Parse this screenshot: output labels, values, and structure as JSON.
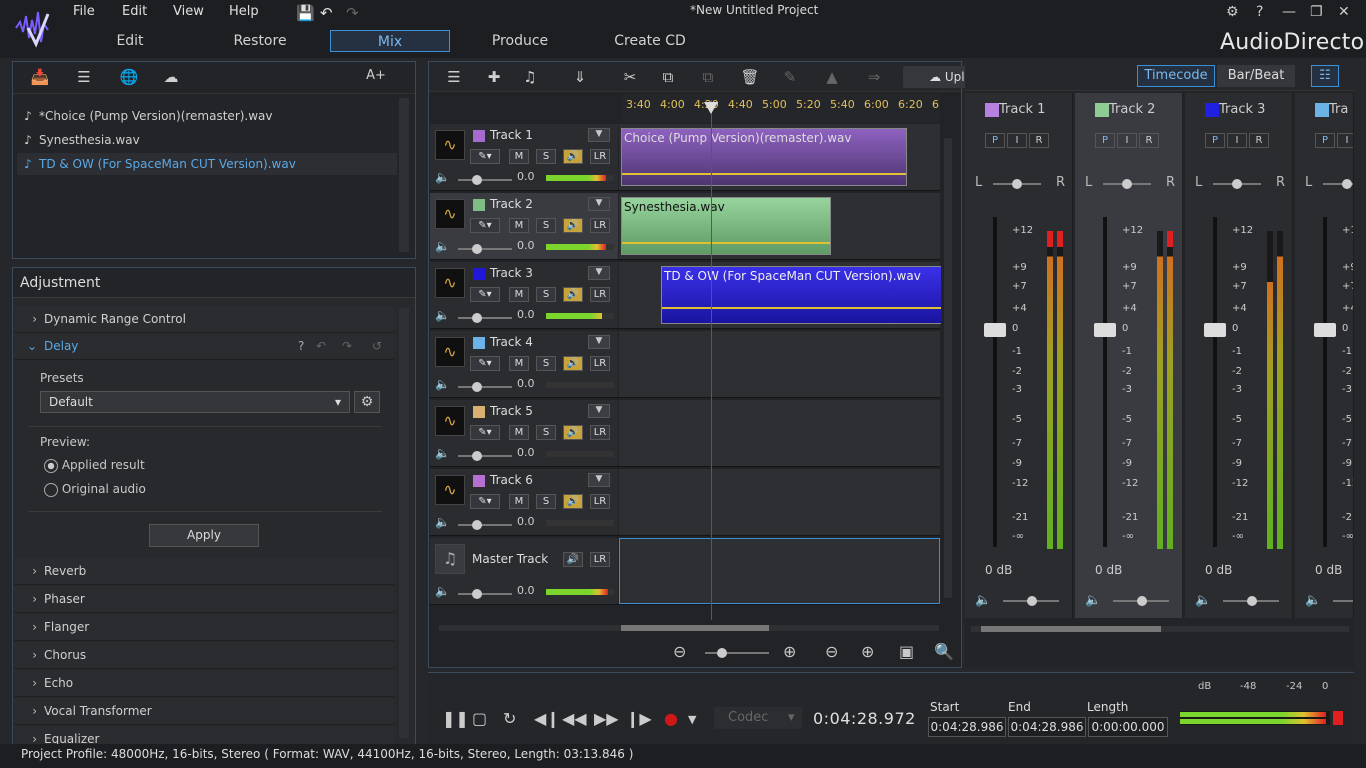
{
  "window": {
    "title": "*New Untitled Project",
    "brand": "AudioDirector"
  },
  "menu": [
    "File",
    "Edit",
    "View",
    "Help"
  ],
  "modes": [
    "Edit",
    "Restore",
    "Mix",
    "Produce",
    "Create CD"
  ],
  "active_mode": "Mix",
  "library": {
    "font_button": "A+",
    "items": [
      {
        "label": "*Choice (Pump Version)(remaster).wav",
        "selected": false
      },
      {
        "label": "Synesthesia.wav",
        "selected": false
      },
      {
        "label": "TD & OW (For SpaceMan CUT Version).wav",
        "selected": true
      }
    ]
  },
  "adjustment": {
    "title": "Adjustment",
    "sections": [
      "Dynamic Range Control",
      "Delay",
      "Reverb",
      "Phaser",
      "Flanger",
      "Chorus",
      "Echo",
      "Vocal Transformer",
      "Equalizer"
    ],
    "presets_label": "Presets",
    "preset_value": "Default",
    "preview_label": "Preview:",
    "options": [
      "Applied result",
      "Original audio"
    ],
    "apply_label": "Apply",
    "help": "?"
  },
  "timeline_toolbar": {
    "upload": "Upload",
    "timecode": "Timecode",
    "barbeat": "Bar/Beat"
  },
  "ruler": [
    "3:40",
    "4:00",
    "4:20",
    "4:40",
    "5:00",
    "5:20",
    "5:40",
    "6:00",
    "6:20",
    "6"
  ],
  "tracks": [
    {
      "name": "Track 1",
      "color": "#a66bd0",
      "vol": "0.0",
      "clip": "Choice (Pump Version)(remaster).wav"
    },
    {
      "name": "Track 2",
      "color": "#7fbb85",
      "vol": "0.0",
      "clip": "Synesthesia.wav"
    },
    {
      "name": "Track 3",
      "color": "#2018d8",
      "vol": "0.0",
      "clip": "TD & OW (For SpaceMan CUT Version).wav"
    },
    {
      "name": "Track 4",
      "color": "#6bb2e6",
      "vol": "0.0",
      "clip": ""
    },
    {
      "name": "Track 5",
      "color": "#d8b070",
      "vol": "0.0",
      "clip": ""
    },
    {
      "name": "Track 6",
      "color": "#b870d0",
      "vol": "0.0",
      "clip": ""
    }
  ],
  "master": {
    "name": "Master Track",
    "vol": "0.0"
  },
  "track_buttons": {
    "m": "M",
    "s": "S",
    "lr": "LR"
  },
  "mixer": {
    "strips": [
      {
        "name": "Track 1",
        "color": "#b880e0",
        "db": "0 dB"
      },
      {
        "name": "Track 2",
        "color": "#8fcc95",
        "db": "0 dB"
      },
      {
        "name": "Track 3",
        "color": "#2020e0",
        "db": "0 dB"
      },
      {
        "name": "Tra",
        "color": "#6bb2e6",
        "db": "0 dB"
      }
    ],
    "pir": [
      "P",
      "I",
      "R"
    ],
    "l": "L",
    "r": "R",
    "scale": [
      "+12",
      "+9",
      "+7",
      "+4",
      "0",
      "-1",
      "-2",
      "-3",
      "-5",
      "-7",
      "-9",
      "-12",
      "-21",
      "-∞"
    ]
  },
  "transport": {
    "codec": "Codec",
    "time": "0:04:28.972",
    "start_label": "Start",
    "start": "0:04:28.986",
    "end_label": "End",
    "end": "0:04:28.986",
    "length_label": "Length",
    "length": "0:00:00.000",
    "meter_labels": [
      "dB",
      "-48",
      "-24",
      "0"
    ]
  },
  "status": "Project Profile: 48000Hz, 16-bits, Stereo ( Format: WAV, 44100Hz, 16-bits, Stereo, Length: 03:13.846 )"
}
